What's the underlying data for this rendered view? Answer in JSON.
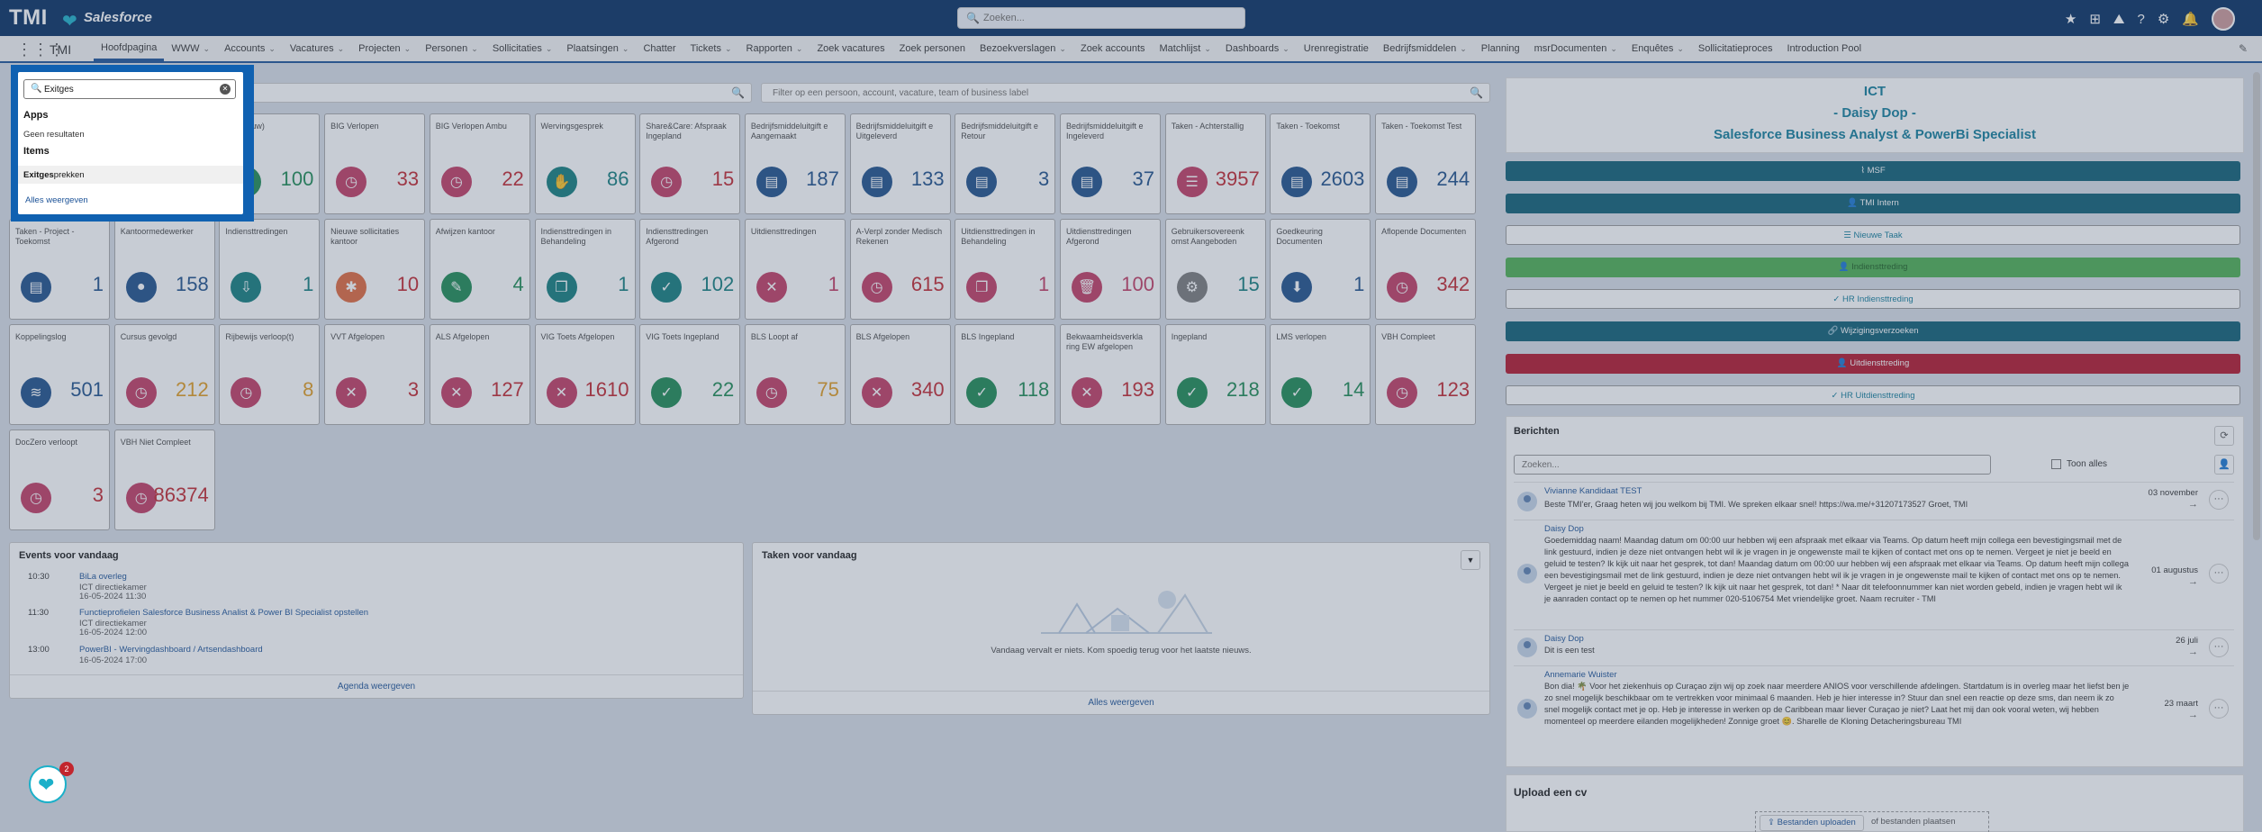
{
  "header": {
    "logo": "TMI",
    "brand": "Salesforce",
    "search_placeholder": "Zoeken..."
  },
  "nav": {
    "app_name": "TMI",
    "items": [
      {
        "label": "Hoofdpagina",
        "chev": false,
        "active": true
      },
      {
        "label": "WWW",
        "chev": true
      },
      {
        "label": "Accounts",
        "chev": true
      },
      {
        "label": "Vacatures",
        "chev": true
      },
      {
        "label": "Projecten",
        "chev": true
      },
      {
        "label": "Personen",
        "chev": true
      },
      {
        "label": "Sollicitaties",
        "chev": true
      },
      {
        "label": "Plaatsingen",
        "chev": true
      },
      {
        "label": "Chatter",
        "chev": false
      },
      {
        "label": "Tickets",
        "chev": true
      },
      {
        "label": "Rapporten",
        "chev": true
      },
      {
        "label": "Zoek vacatures",
        "chev": false
      },
      {
        "label": "Zoek personen",
        "chev": false
      },
      {
        "label": "Bezoekverslagen",
        "chev": true
      },
      {
        "label": "Zoek accounts",
        "chev": false
      },
      {
        "label": "Matchlijst",
        "chev": true
      },
      {
        "label": "Dashboards",
        "chev": true
      },
      {
        "label": "Urenregistratie",
        "chev": false
      },
      {
        "label": "Bedrijfsmiddelen",
        "chev": true
      },
      {
        "label": "Planning",
        "chev": false
      },
      {
        "label": "msrDocumenten",
        "chev": true
      },
      {
        "label": "Enquêtes",
        "chev": true
      },
      {
        "label": "Sollicitatieproces",
        "chev": false
      },
      {
        "label": "Introduction Pool",
        "chev": false
      }
    ]
  },
  "filter": {
    "placeholder": "Filter op een persoon, account, vacature, team of business label"
  },
  "tiles": [
    {
      "label": "",
      "value": "",
      "icon": "",
      "color": "teal"
    },
    {
      "label": "",
      "value": "",
      "icon": "",
      "color": "teal"
    },
    {
      "label": "en (Nieuw)",
      "value": "100",
      "icon": "check-icon",
      "color": "green"
    },
    {
      "label": "BIG Verlopen",
      "value": "33",
      "icon": "clock-icon",
      "color": "pink"
    },
    {
      "label": "BIG Verlopen Ambu",
      "value": "22",
      "icon": "clock-icon",
      "color": "pink"
    },
    {
      "label": "Wervingsgesprek",
      "value": "86",
      "icon": "handshake-icon",
      "color": "teal"
    },
    {
      "label": "Share&Care: Afspraak Ingepland",
      "value": "15",
      "icon": "clock-icon",
      "color": "pink"
    },
    {
      "label": "Bedrijfsmiddeluitgift e Aangemaakt",
      "value": "187",
      "icon": "clipboard-icon",
      "color": "blue"
    },
    {
      "label": "Bedrijfsmiddeluitgift e Uitgeleverd",
      "value": "133",
      "icon": "clipboard-icon",
      "color": "blue"
    },
    {
      "label": "Bedrijfsmiddeluitgift e Retour",
      "value": "3",
      "icon": "clipboard-icon",
      "color": "blue"
    },
    {
      "label": "Bedrijfsmiddeluitgift e Ingeleverd",
      "value": "37",
      "icon": "clipboard-icon",
      "color": "blue"
    },
    {
      "label": "Taken - Achterstallig",
      "value": "3957",
      "icon": "list-icon",
      "color": "pink"
    },
    {
      "label": "Taken - Toekomst",
      "value": "2603",
      "icon": "clipboard-icon",
      "color": "blue"
    },
    {
      "label": "Taken - Toekomst Test",
      "value": "244",
      "icon": "clipboard-icon",
      "color": "blue"
    },
    {
      "label": "Taken - Project - Toekomst",
      "value": "1",
      "icon": "clipboard-icon",
      "color": "blue"
    },
    {
      "label": "Kantoormedewerker",
      "value": "158",
      "icon": "user-icon",
      "color": "blue"
    },
    {
      "label": "Indiensttredingen",
      "value": "1",
      "icon": "inbox-icon",
      "color": "teal"
    },
    {
      "label": "Nieuwe sollicitaties kantoor",
      "value": "10",
      "icon": "person-icon",
      "color": "orange"
    },
    {
      "label": "Afwijzen kantoor",
      "value": "4",
      "icon": "pencil-icon",
      "color": "green"
    },
    {
      "label": "Indiensttredingen in Behandeling",
      "value": "1",
      "icon": "copy-icon",
      "color": "teal"
    },
    {
      "label": "Indiensttredingen Afgerond",
      "value": "102",
      "icon": "check-icon",
      "color": "teal"
    },
    {
      "label": "Uitdiensttredingen",
      "value": "1",
      "icon": "close-icon",
      "color": "pink"
    },
    {
      "label": "A-Verpl zonder Medisch Rekenen",
      "value": "615",
      "icon": "clock-icon",
      "color": "pink"
    },
    {
      "label": "Uitdiensttredingen in Behandeling",
      "value": "1",
      "icon": "copy-icon",
      "color": "pink"
    },
    {
      "label": "Uitdiensttredingen Afgerond",
      "value": "100",
      "icon": "trash-icon",
      "color": "pink"
    },
    {
      "label": "Gebruikersovereenk omst Aangeboden",
      "value": "15",
      "icon": "gear-icon",
      "color": "gray"
    },
    {
      "label": "Goedkeuring Documenten",
      "value": "1",
      "icon": "download-icon",
      "color": "blue"
    },
    {
      "label": "Aflopende Documenten",
      "value": "342",
      "icon": "clock-icon",
      "color": "pink"
    },
    {
      "label": "Koppelingslog",
      "value": "501",
      "icon": "wave-icon",
      "color": "blue"
    },
    {
      "label": "Cursus gevolgd",
      "value": "212",
      "icon": "clock-icon",
      "color": "pink"
    },
    {
      "label": "Rijbewijs verloop(t)",
      "value": "8",
      "icon": "clock-icon",
      "color": "pink"
    },
    {
      "label": "VVT Afgelopen",
      "value": "3",
      "icon": "close-icon",
      "color": "pink"
    },
    {
      "label": "ALS Afgelopen",
      "value": "127",
      "icon": "close-icon",
      "color": "pink"
    },
    {
      "label": "VIG Toets Afgelopen",
      "value": "1610",
      "icon": "close-icon",
      "color": "pink"
    },
    {
      "label": "VIG Toets Ingepland",
      "value": "22",
      "icon": "check-icon",
      "color": "green"
    },
    {
      "label": "BLS Loopt af",
      "value": "75",
      "icon": "clock-icon",
      "color": "pink"
    },
    {
      "label": "BLS Afgelopen",
      "value": "340",
      "icon": "close-icon",
      "color": "pink"
    },
    {
      "label": "BLS Ingepland",
      "value": "118",
      "icon": "check-icon",
      "color": "green"
    },
    {
      "label": "Bekwaamheidsverkla ring EW afgelopen",
      "value": "193",
      "icon": "close-icon",
      "color": "pink"
    },
    {
      "label": "Ingepland",
      "value": "218",
      "icon": "check-icon",
      "color": "green"
    },
    {
      "label": "LMS verlopen",
      "value": "14",
      "icon": "check-icon",
      "color": "green"
    },
    {
      "label": "VBH Compleet",
      "value": "123",
      "icon": "clock-icon",
      "color": "pink"
    },
    {
      "label": "DocZero verloopt",
      "value": "3",
      "icon": "clock-icon",
      "color": "pink"
    },
    {
      "label": "VBH Niet Compleet",
      "value": "86374",
      "icon": "clock-icon",
      "color": "pink"
    }
  ],
  "events": {
    "title": "Events voor vandaag",
    "items": [
      {
        "time": "10:30",
        "title": "BiLa overleg",
        "sub": "ICT directiekamer",
        "date": "16-05-2024 11:30"
      },
      {
        "time": "11:30",
        "title": "Functieprofielen Salesforce Business Analist & Power BI Specialist opstellen",
        "sub": "ICT directiekamer",
        "date": "16-05-2024 12:00"
      },
      {
        "time": "13:00",
        "title": "PowerBI - Wervingdashboard / Artsendashboard",
        "sub": "",
        "date": "16-05-2024 17:00"
      }
    ],
    "footer": "Agenda weergeven"
  },
  "tasks": {
    "title": "Taken voor vandaag",
    "empty": "Vandaag vervalt er niets. Kom spoedig terug voor het laatste nieuws.",
    "footer": "Alles weergeven"
  },
  "profile": {
    "line1": "ICT",
    "line2": "- Daisy Dop -",
    "line3": "Salesforce Business Analyst & PowerBi Specialist"
  },
  "right_buttons": [
    {
      "label": "MSF",
      "style": "dark",
      "icon": "chart-icon"
    },
    {
      "label": "TMI Intern",
      "style": "dark",
      "icon": "user-icon"
    },
    {
      "label": "Nieuwe Taak",
      "style": "outline",
      "icon": "task-icon"
    },
    {
      "label": "Indiensttreding",
      "style": "green",
      "icon": "user-add-icon"
    },
    {
      "label": "HR Indiensttreding",
      "style": "outline",
      "icon": "check-icon"
    },
    {
      "label": "Wijzigingsverzoeken",
      "style": "dark",
      "icon": "link-icon"
    },
    {
      "label": "Uitdiensttreding",
      "style": "red",
      "icon": "user-remove-icon"
    },
    {
      "label": "HR Uitdiensttreding",
      "style": "outline",
      "icon": "check-icon"
    }
  ],
  "berichten": {
    "title": "Berichten",
    "search_placeholder": "Zoeken...",
    "show_all": "Toon alles",
    "messages": [
      {
        "sender": "Vivianne Kandidaat TEST",
        "text": "Beste TMI'er, Graag heten wij jou welkom bij TMI. We spreken elkaar snel! https://wa.me/+31207173527 Groet, TMI",
        "date": "03 november"
      },
      {
        "sender": "Daisy Dop",
        "text": "Goedemiddag naam! Maandag datum om 00:00 uur hebben wij een afspraak met elkaar via Teams. Op datum heeft mijn collega een bevestigingsmail met de link gestuurd, indien je deze niet ontvangen hebt wil ik je vragen in je ongewenste mail te kijken of contact met ons op te nemen. Vergeet je niet je beeld en geluid te testen? Ik kijk uit naar het gesprek, tot dan! Maandag datum om 00:00 uur hebben wij een afspraak met elkaar via Teams. Op datum heeft mijn collega een bevestigingsmail met de link gestuurd, indien je deze niet ontvangen hebt wil ik je vragen in je ongewenste mail te kijken of contact met ons op te nemen. Vergeet je niet je beeld en geluid te testen? Ik kijk uit naar het gesprek, tot dan! * Naar dit telefoonnummer kan niet worden gebeld, indien je vragen hebt wil ik je aanraden contact op te nemen op het nummer 020-5106754 Met vriendelijke groet. Naam recruiter - TMI",
        "date": "01 augustus"
      },
      {
        "sender": "Daisy Dop",
        "text": "Dit is een test",
        "date": "26 juli"
      },
      {
        "sender": "Annemarie Wuister",
        "text": "Bon dia! 🌴 Voor het ziekenhuis op Curaçao zijn wij op zoek naar meerdere ANIOS voor verschillende afdelingen. Startdatum is in overleg maar het liefst ben je zo snel mogelijk beschikbaar om te vertrekken voor minimaal 6 maanden. Heb je hier interesse in? Stuur dan snel een reactie op deze sms, dan neem ik zo snel mogelijk contact met je op. Heb je interesse in werken op de Caribbean maar liever Curaçao je niet? Laat het mij dan ook vooral weten, wij hebben momenteel op meerdere eilanden mogelijkheden! Zonnige groet 😊. Sharelle de Kloning Detacheringsbureau TMI",
        "date": "23 maart"
      }
    ]
  },
  "upload": {
    "title": "Upload een cv",
    "button": "Bestanden uploaden",
    "or_text": "of bestanden plaatsen"
  },
  "search_popup": {
    "query": "Exitges",
    "apps_heading": "Apps",
    "no_results": "Geen resultaten",
    "items_heading": "Items",
    "result_bold": "Exitges",
    "result_rest": "prekken",
    "show_all": "Alles weergeven"
  },
  "fab": {
    "badge": "2"
  },
  "colors": {
    "header": "#032d60",
    "accent": "#1061b1",
    "teal": "#117c7c",
    "pink": "#c23a62",
    "blue": "#1c4e8a",
    "green": "#1b8a52"
  }
}
